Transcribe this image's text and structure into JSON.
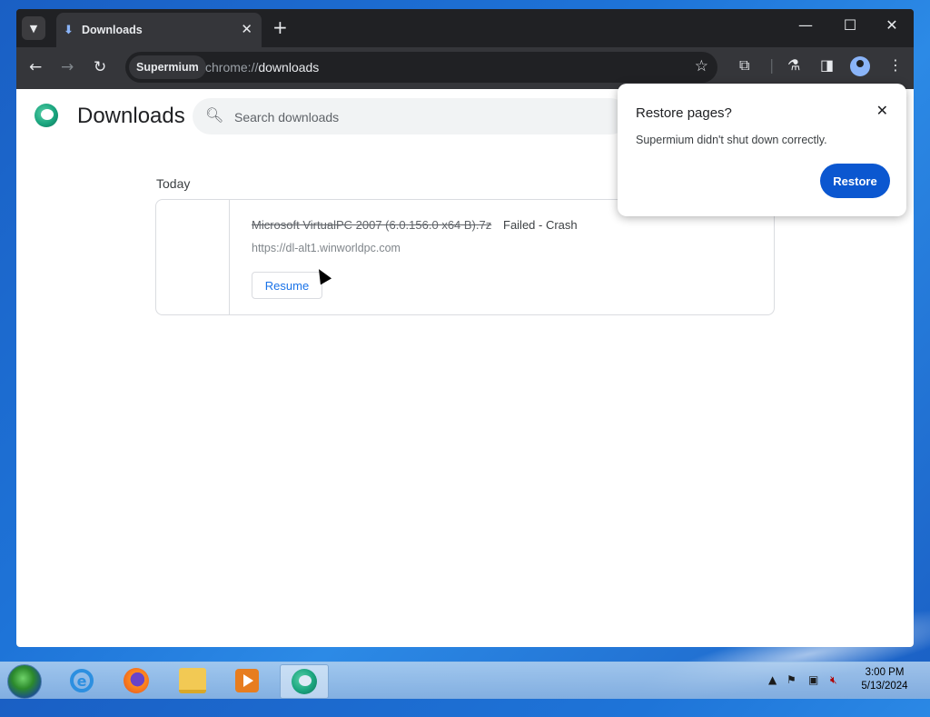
{
  "browser": {
    "tab_title": "Downloads",
    "url_chip": "Supermium",
    "url_scheme": "chrome://",
    "url_host": "downloads"
  },
  "page": {
    "title": "Downloads",
    "search_placeholder": "Search downloads",
    "date_header": "Today",
    "download": {
      "filename": "Microsoft VirtualPC 2007 (6.0.156.0 x64 B).7z",
      "status": "Failed - Crash",
      "source": "https://dl-alt1.winworldpc.com",
      "resume_label": "Resume"
    }
  },
  "popup": {
    "title": "Restore pages?",
    "message": "Supermium didn't shut down correctly.",
    "button": "Restore"
  },
  "taskbar": {
    "time": "3:00 PM",
    "date": "5/13/2024"
  },
  "icons": {
    "tab_search": "chevron-down-icon",
    "download": "download-icon",
    "close": "close-icon",
    "new_tab": "plus-icon",
    "back": "back-arrow-icon",
    "forward": "forward-arrow-icon",
    "reload": "reload-icon",
    "bookmark": "star-icon",
    "extensions": "puzzle-icon",
    "labs": "flask-icon",
    "side_panel": "side-panel-icon",
    "profile": "profile-icon",
    "menu": "kebab-menu-icon",
    "search": "search-icon"
  },
  "colors": {
    "accent": "#0b57d0",
    "link": "#1a73e8"
  }
}
